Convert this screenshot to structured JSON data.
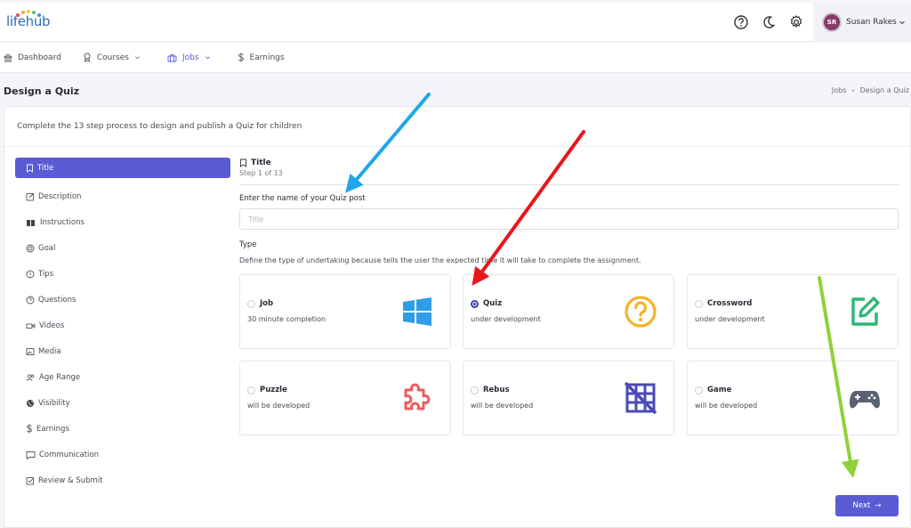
{
  "app": {
    "logo": "lifehub"
  },
  "header": {
    "user_initials": "SR",
    "user_name": "Susan Rakes"
  },
  "nav": [
    {
      "label": "Dashboard",
      "icon": "bank-icon",
      "dropdown": false
    },
    {
      "label": "Courses",
      "icon": "award-icon",
      "dropdown": true
    },
    {
      "label": "Jobs",
      "icon": "briefcase-icon",
      "dropdown": true
    },
    {
      "label": "Earnings",
      "icon": "dollar-icon",
      "dropdown": false
    }
  ],
  "page": {
    "title": "Design a Quiz",
    "breadcrumb": [
      "Jobs",
      "Design a Quiz"
    ],
    "intro": "Complete the 13 step process to design and publish a Quiz for children"
  },
  "steps": [
    "Title",
    "Description",
    "Instructions",
    "Goal",
    "Tips",
    "Questions",
    "Videos",
    "Media",
    "Age Range",
    "Visibility",
    "Earnings",
    "Communication",
    "Review & Submit"
  ],
  "form": {
    "section_title": "Title",
    "section_step": "Step 1 of 13",
    "name_label": "Enter the name of your Quiz post",
    "name_placeholder": "Title",
    "type_label": "Type",
    "type_desc": "Define the type of undertaking because tells the user the expected time it will take to complete the assignment."
  },
  "options": [
    {
      "name": "Job",
      "desc": "30 minute completion",
      "icon": "windows-icon",
      "color": "#2f9ee6"
    },
    {
      "name": "Quiz",
      "desc": "under development",
      "icon": "question-circle-icon",
      "color": "#f4b428"
    },
    {
      "name": "Crossword",
      "desc": "under development",
      "icon": "edit-box-icon",
      "color": "#2bb673"
    },
    {
      "name": "Puzzle",
      "desc": "will be developed",
      "icon": "puzzle-icon",
      "color": "#ef5d5d"
    },
    {
      "name": "Rebus",
      "desc": "will be developed",
      "icon": "grid-off-icon",
      "color": "#4a4ab8"
    },
    {
      "name": "Game",
      "desc": "will be developed",
      "icon": "gamepad-icon",
      "color": "#5a6274"
    }
  ],
  "selected_option": "Quiz",
  "actions": {
    "next": "Next"
  },
  "colors": {
    "accent": "#5b5bd6",
    "annotation_blue": "#1ea7ea",
    "annotation_red": "#e8161b",
    "annotation_green": "#8fd13a"
  }
}
